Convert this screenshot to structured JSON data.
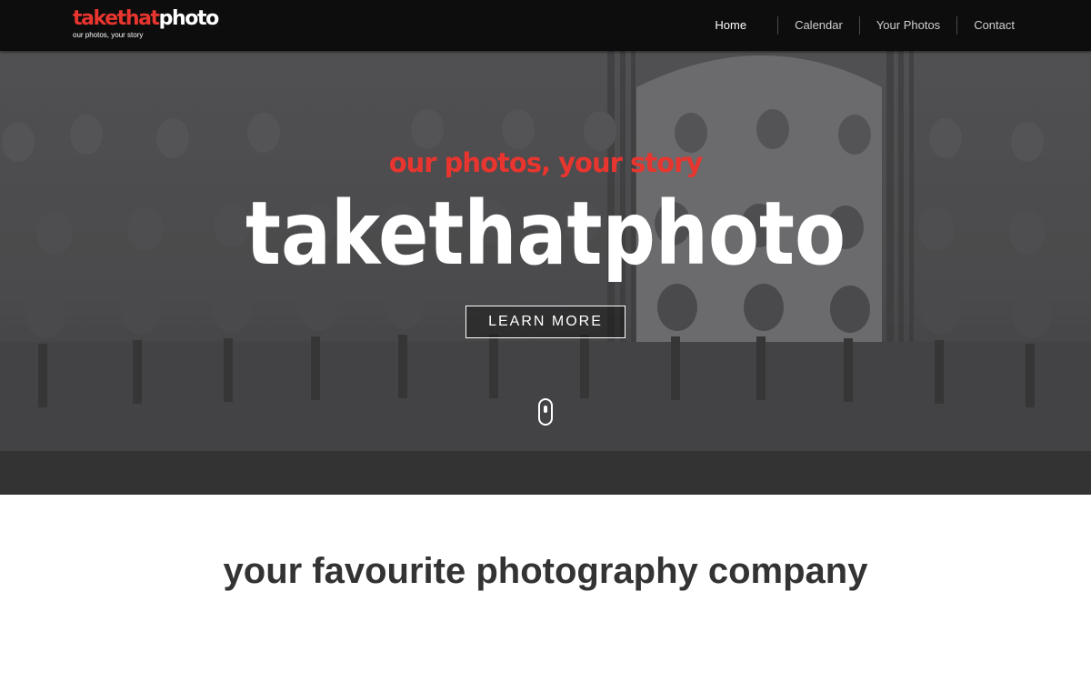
{
  "header": {
    "logo": {
      "word_red": "takethat",
      "word_white": "photo",
      "tagline": "our photos, your story"
    },
    "nav": [
      {
        "label": "Home"
      },
      {
        "label": "Calendar"
      },
      {
        "label": "Your Photos"
      },
      {
        "label": "Contact"
      }
    ]
  },
  "hero": {
    "tagline": "our photos, your story",
    "wordmark": "takethatphoto",
    "button_label": "LEARN MORE",
    "scroll_icon": "mouse-scroll-icon"
  },
  "main": {
    "headline": "your favourite photography company"
  },
  "colors": {
    "brand_red": "#e8352f",
    "navbar": "#0d0d0d",
    "overlay": "#555555",
    "headline": "#333333"
  }
}
